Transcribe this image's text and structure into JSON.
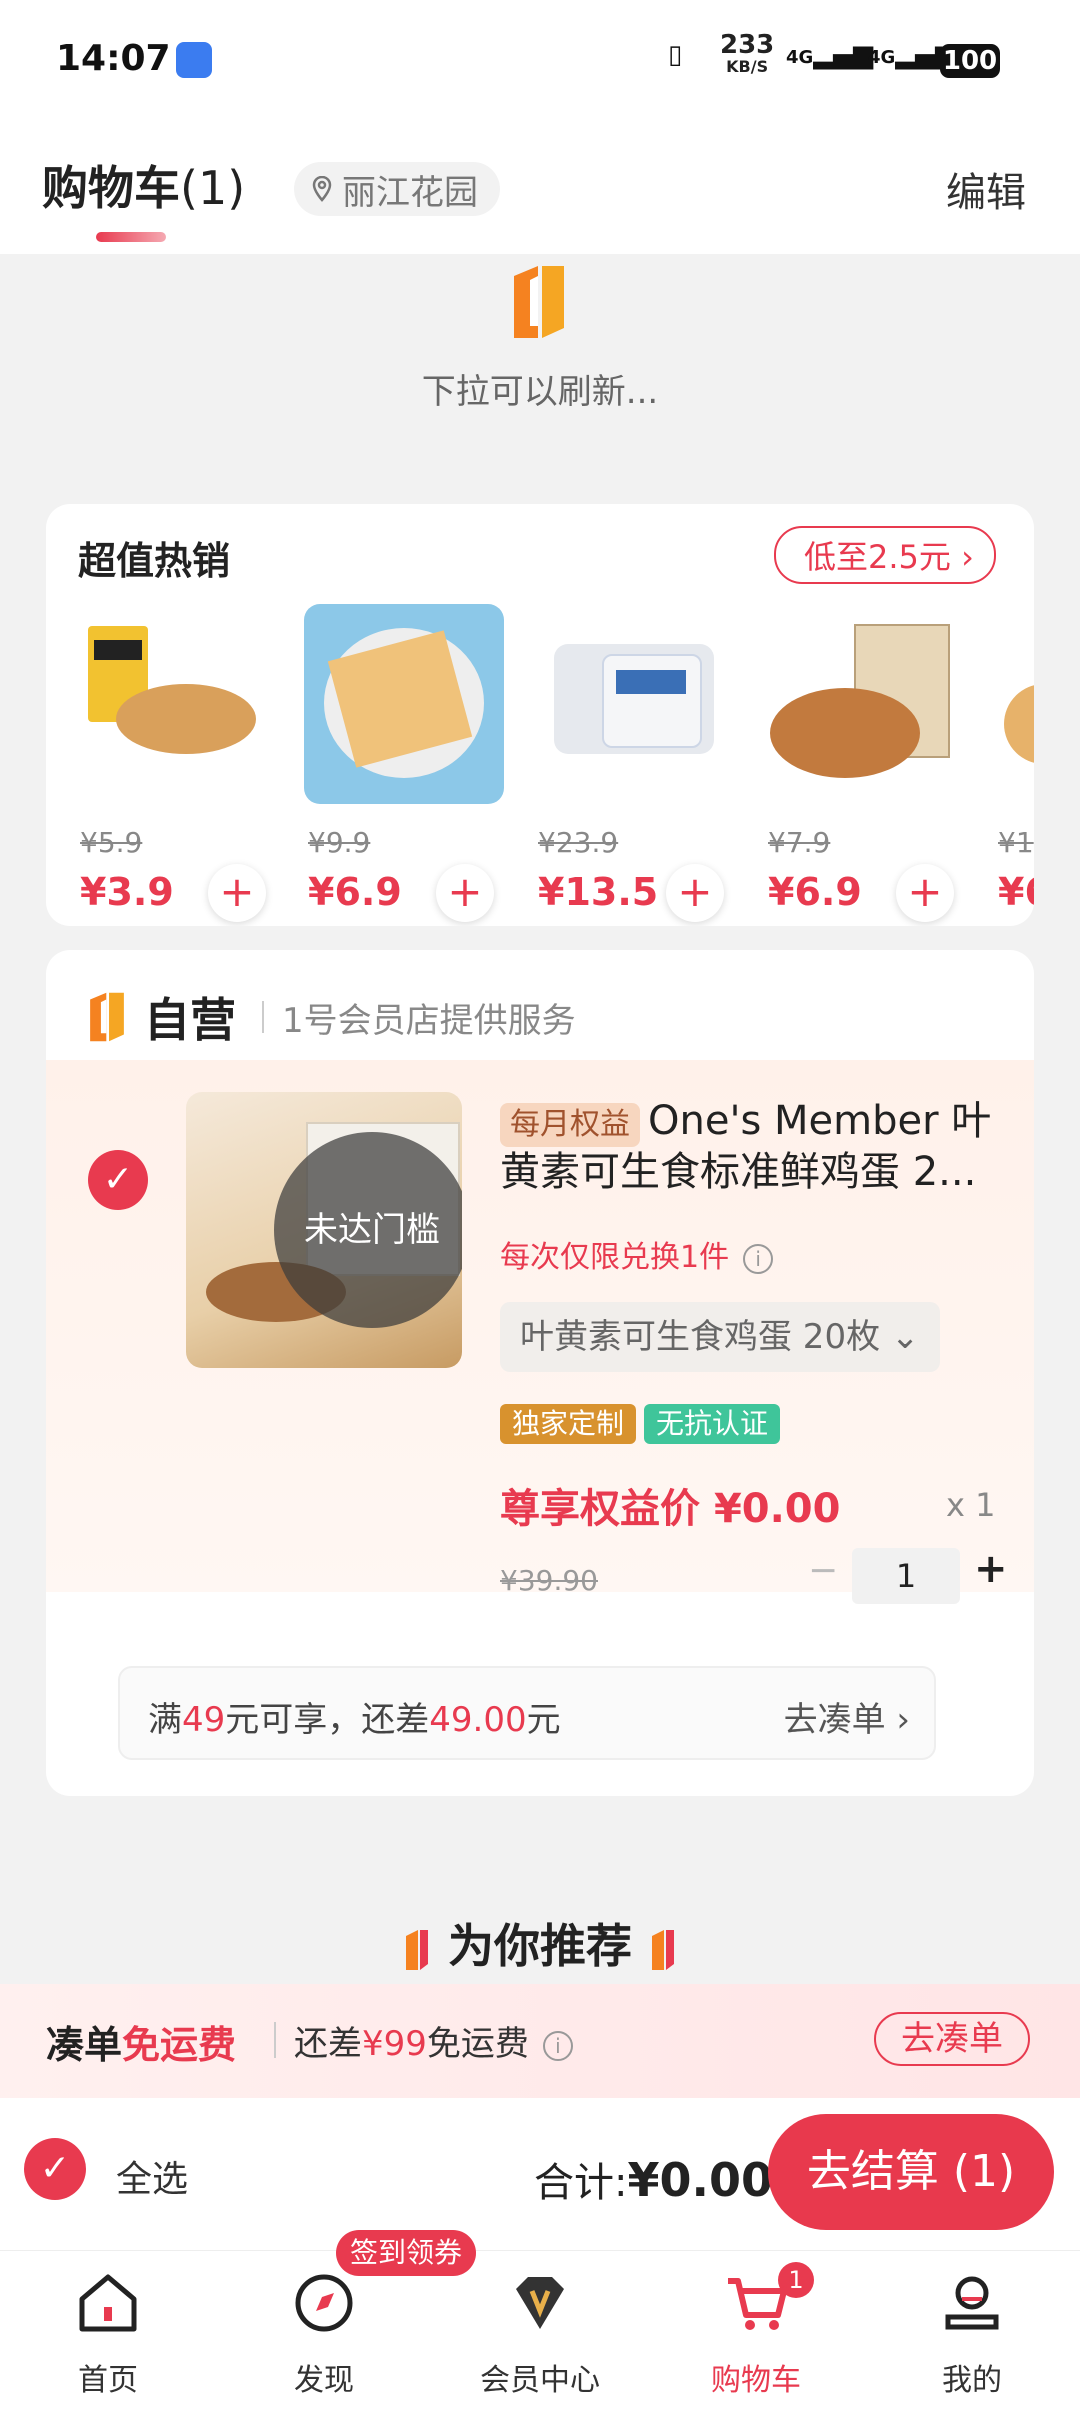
{
  "status_bar": {
    "time": "14:07",
    "speed": "233",
    "speed_unit": "KB/S",
    "net1": "4G",
    "net2": "4G",
    "battery": "100"
  },
  "header": {
    "title": "购物车",
    "count": "(1)",
    "location": "丽江花园",
    "edit": "编辑"
  },
  "refresh_hint": "下拉可以刷新...",
  "hot_sales": {
    "title": "超值热销",
    "low_price": "低至2.5元 ›",
    "products": [
      {
        "old_price": "¥5.9",
        "price": "¥3.9",
        "image": "chips-bag"
      },
      {
        "old_price": "¥9.9",
        "price": "¥6.9",
        "image": "crackers"
      },
      {
        "old_price": "¥23.9",
        "price": "¥13.5",
        "image": "yogurt-box"
      },
      {
        "old_price": "¥7.9",
        "price": "¥6.9",
        "image": "dried-figs"
      },
      {
        "old_price": "¥1",
        "price": "¥6",
        "image": "partial-product"
      }
    ]
  },
  "self_store": {
    "name": "自营",
    "subtitle": "1号会员店提供服务",
    "item": {
      "tag": "每月权益",
      "title": "One's Member 叶黄素可生食标准鲜鸡蛋 2...",
      "overlay": "未达门槛",
      "limit": "每次仅限兑换1件",
      "spec": "叶黄素可生食鸡蛋 20枚 ⌄",
      "tags": [
        "独家定制",
        "无抗认证"
      ],
      "price_label": "尊享权益价",
      "price": "¥0.00",
      "qty_times": "x 1",
      "old_price": "¥39.90",
      "minus": "−",
      "qty": "1",
      "plus": "+"
    },
    "threshold": {
      "prefix": "满",
      "amount": "49",
      "mid": "元可享，还差",
      "diff": "49.00",
      "suffix": "元",
      "go": "去凑单 ›"
    }
  },
  "recommend": {
    "title": "为你推荐"
  },
  "shipping": {
    "title_a": "凑单",
    "title_b": "免运费",
    "sub_a": "还差",
    "sub_amount": "¥99",
    "sub_b": "免运费",
    "button": "去凑单"
  },
  "checkout": {
    "select_all": "全选",
    "total_label": "合计:",
    "total": "¥0.00",
    "button": "去结算 (1)"
  },
  "tabs": [
    {
      "label": "首页",
      "icon": "home-icon"
    },
    {
      "label": "发现",
      "icon": "discover-icon"
    },
    {
      "label": "会员中心",
      "icon": "vip-icon"
    },
    {
      "label": "购物车",
      "icon": "cart-icon",
      "active": true
    },
    {
      "label": "我的",
      "icon": "profile-icon"
    }
  ],
  "tab_badges": {
    "discover": "签到领券",
    "cart": "1"
  },
  "colors": {
    "accent": "#e83a4f",
    "orange": "#f58220"
  }
}
